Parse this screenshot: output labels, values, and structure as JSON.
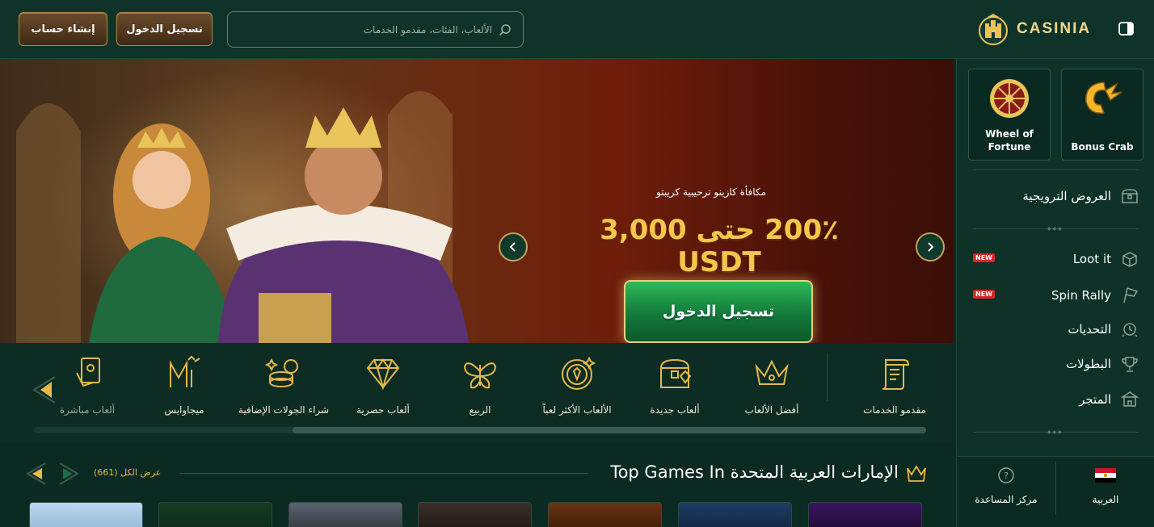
{
  "header": {
    "register_label": "إنشاء حساب",
    "login_label": "تسجيل الدخول",
    "search_placeholder": "الألعاب، الفئات، مقدمو الخدمات",
    "logo_text": "CASINIA"
  },
  "banner": {
    "subtitle": "مكافأة كازينو ترحيبية كريبتو",
    "title": "200٪ حتى 3,000 USDT",
    "cta_label": "تسجيل الدخول",
    "slides_total": 4,
    "active_slide": 2
  },
  "categories": [
    {
      "label": "مقدمو الخدمات",
      "icon": "scroll-icon"
    },
    {
      "label": "أفضل الألعاب",
      "icon": "crown-icon"
    },
    {
      "label": "ألعاب جديدة",
      "icon": "treasure-chest-icon"
    },
    {
      "label": "الألعاب الأكثر لعباً",
      "icon": "coin-icon"
    },
    {
      "label": "الربيع",
      "icon": "butterfly-icon"
    },
    {
      "label": "ألعاب حصرية",
      "icon": "diamond-icon"
    },
    {
      "label": "شراء الجولات الإضافية",
      "icon": "coins-stack-icon"
    },
    {
      "label": "ميجاوايس",
      "icon": "megaways-icon"
    },
    {
      "label": "ألعاب مباشرة",
      "icon": "live-cards-icon"
    }
  ],
  "top_games": {
    "title": "Top Games In الإمارات العربية المتحدة",
    "view_all": "عرض الكل",
    "count": "(661)"
  },
  "sidebar": {
    "tiles": [
      {
        "label": "Wheel of Fortune"
      },
      {
        "label": "Bonus Crab"
      }
    ],
    "promotions": "العروض الترويجية",
    "items": [
      {
        "label": "Loot it",
        "badge": "NEW"
      },
      {
        "label": "Spin Rally",
        "badge": "NEW"
      },
      {
        "label": "التحديات"
      },
      {
        "label": "البطولات"
      },
      {
        "label": "المتجر"
      }
    ],
    "help_center": "مركز المساعدة",
    "language": "العربية"
  },
  "colors": {
    "background": "#0b2a22",
    "gold": "#f5c64a",
    "cta_green": "#13793a",
    "badge_red": "#d62828"
  }
}
